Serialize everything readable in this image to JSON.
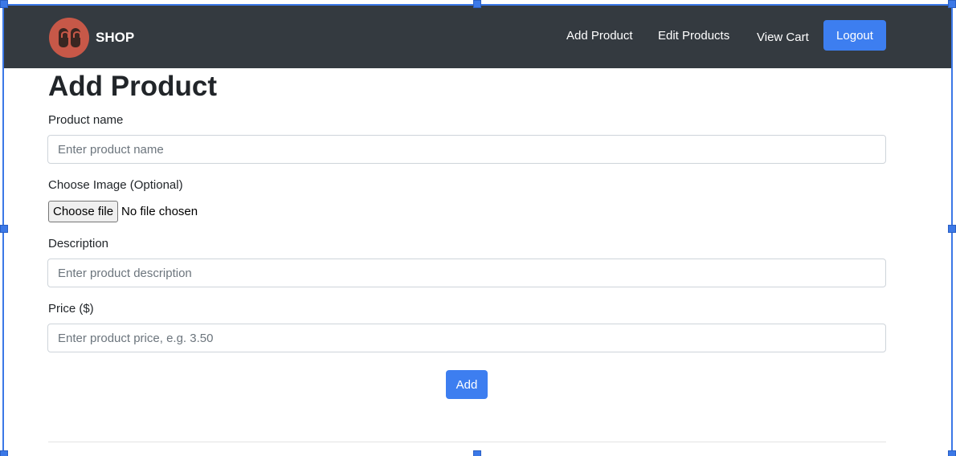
{
  "navbar": {
    "brand": "SHOP",
    "links": [
      "Add Product",
      "Edit Products",
      "View Cart"
    ],
    "logout_label": "Logout",
    "logo_icon": "sandals-logo-icon"
  },
  "form": {
    "title": "Add Product",
    "name_label": "Product name",
    "name_placeholder": "Enter product name",
    "image_label": "Choose Image (Optional)",
    "file_button": "Choose file",
    "file_status": "No file chosen",
    "description_label": "Description",
    "description_placeholder": "Enter product description",
    "price_label": "Price ($)",
    "price_placeholder": "Enter product price, e.g. 3.50",
    "submit_label": "Add"
  },
  "colors": {
    "navbar_bg": "#343a40",
    "primary": "#3d7ef0",
    "logo_bg": "#c75848",
    "selection_frame": "#3b78e7"
  }
}
